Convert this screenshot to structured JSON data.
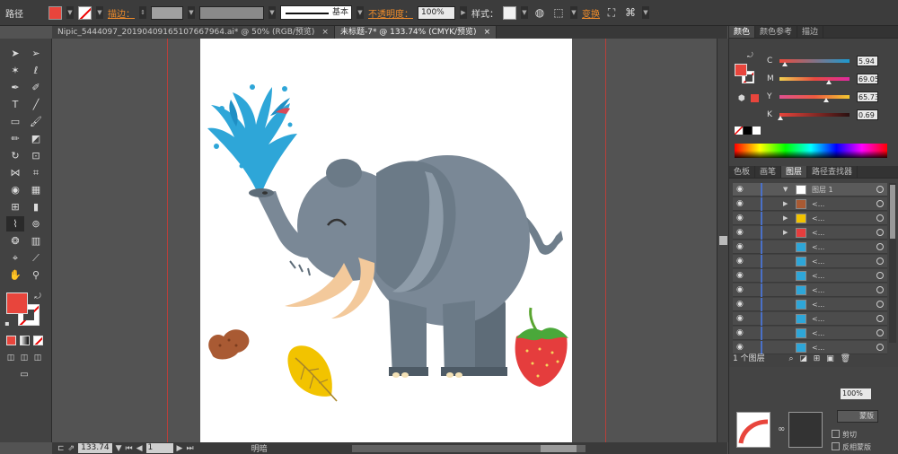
{
  "control_bar": {
    "object_label": "路径",
    "stroke_label": "描边：",
    "stroke_profile": "基本",
    "opacity_label": "不透明度：",
    "opacity_value": "100%",
    "style_label": "样式：",
    "transform_label": "变换",
    "fill_color": "#e8453c"
  },
  "doc_tabs": [
    {
      "name": "Nipic_5444097_20190409165107667964.ai* @ 50% (RGB/预览)"
    },
    {
      "name": "未标题-7* @ 133.74% (CMYK/预览)"
    }
  ],
  "tools": {
    "fill_color": "#e8453c"
  },
  "status_bar": {
    "zoom": "133.74",
    "page": "1",
    "mode": "明暗"
  },
  "color_panel": {
    "tabs": [
      "颜色",
      "颜色参考",
      "描边"
    ],
    "channels": [
      {
        "name": "C",
        "value": "5.94",
        "pos": 0.06
      },
      {
        "name": "M",
        "value": "69.05",
        "pos": 0.69
      },
      {
        "name": "Y",
        "value": "65.73",
        "pos": 0.66
      },
      {
        "name": "K",
        "value": "0.69",
        "pos": 0.01
      }
    ],
    "fill_color": "#e8453c"
  },
  "layers_panel": {
    "tabs": [
      "色板",
      "画笔",
      "图层",
      "路径查找器"
    ],
    "layer_name": "图层 1",
    "sublayer_label": "<...",
    "footer": "1 个图层"
  },
  "bottom_panel": {
    "value": "100%",
    "release_label": "蒙版",
    "clip_label": "剪切",
    "invert_label": "反相蒙版"
  }
}
